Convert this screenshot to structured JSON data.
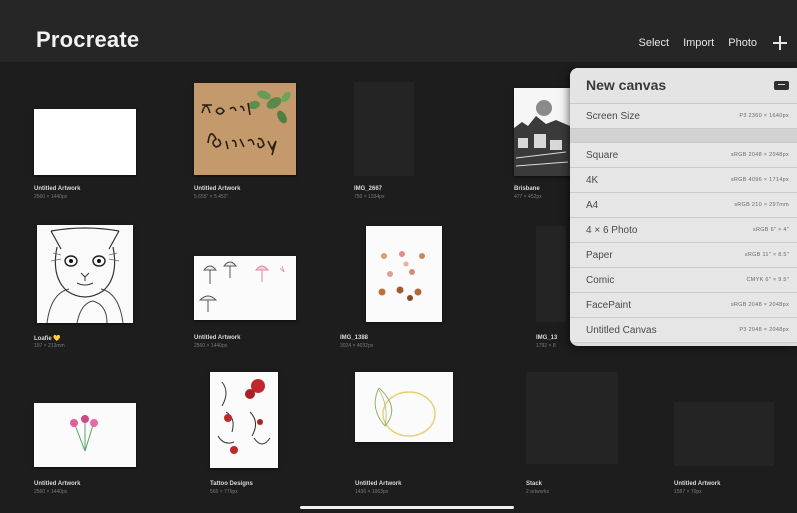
{
  "app": {
    "title": "Procreate"
  },
  "toolbar": {
    "select": "Select",
    "import": "Import",
    "photo": "Photo",
    "add_icon": "plus-icon"
  },
  "gallery": {
    "items": [
      {
        "label": "Untitled Artwork",
        "size": "2560 × 1440px"
      },
      {
        "label": "Untitled Artwork",
        "size": "5.655\" × 5.452\"",
        "art_text": "Happy Birthday"
      },
      {
        "label": "IMG_2667",
        "size": "750 × 1334px"
      },
      {
        "label": "Brisbane",
        "size": "477 × 452px"
      },
      {
        "label": "Loafie 💛",
        "size": "197 × 213mm"
      },
      {
        "label": "Untitled Artwork",
        "size": "2560 × 1440px"
      },
      {
        "label": "IMG_1388",
        "size": "3024 × 4032px"
      },
      {
        "label": "IMG_13",
        "size": "1792 × 8"
      },
      {
        "label": "Untitled Artwork",
        "size": "2560 × 1440px"
      },
      {
        "label": "Tattoo Designs",
        "size": "565 × 776px"
      },
      {
        "label": "Untitled Artwork",
        "size": "1436 × 1063px"
      },
      {
        "label": "Stack",
        "size": "2 artworks"
      },
      {
        "label": "Untitled Artwork",
        "size": "1587 × 70px"
      }
    ]
  },
  "new_canvas": {
    "title": "New canvas",
    "folder_icon": "new-folder-icon",
    "screen_size": {
      "name": "Screen Size",
      "spec": "P3   2360 × 1640px"
    },
    "presets": [
      {
        "name": "Square",
        "spec": "sRGB   2048 × 2048px"
      },
      {
        "name": "4K",
        "spec": "sRGB   4096 × 1714px"
      },
      {
        "name": "A4",
        "spec": "sRGB   210 × 297mm"
      },
      {
        "name": "4 × 6 Photo",
        "spec": "sRGB   6\" × 4\""
      },
      {
        "name": "Paper",
        "spec": "sRGB   11\" × 8.5\""
      },
      {
        "name": "Comic",
        "spec": "CMYK   6\" × 9.5\""
      },
      {
        "name": "FacePaint",
        "spec": "sRGB   2048 × 2048px"
      },
      {
        "name": "Untitled Canvas",
        "spec": "P3   2048 × 2048px"
      }
    ]
  }
}
